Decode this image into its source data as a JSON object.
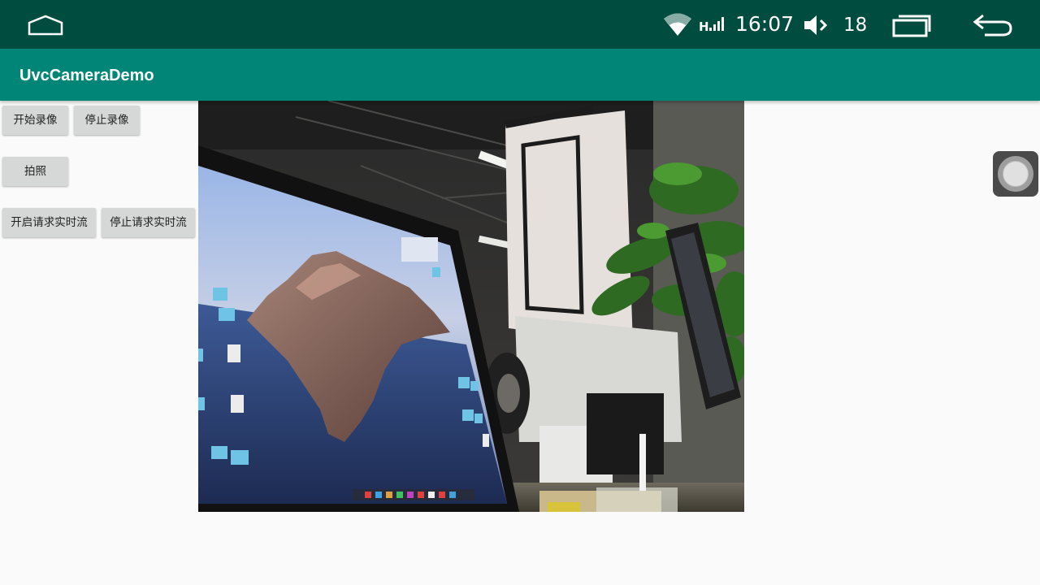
{
  "status_bar": {
    "time": "16:07",
    "volume_level": "18",
    "network_label": "H",
    "icons": [
      "home-icon",
      "wifi-icon",
      "signal-icon",
      "volume-icon",
      "recent-apps-icon",
      "back-icon"
    ]
  },
  "app_bar": {
    "title": "UvcCameraDemo"
  },
  "buttons": {
    "start_record": "开始录像",
    "stop_record": "停止录像",
    "take_photo": "拍照",
    "start_stream": "开启请求实时流",
    "stop_stream": "停止请求实时流"
  },
  "floating_button": {
    "icon": "assistive-touch-icon"
  },
  "colors": {
    "status_bar": "#004d40",
    "app_bar": "#008577",
    "background": "#fafafa",
    "button": "#d6d7d7"
  }
}
